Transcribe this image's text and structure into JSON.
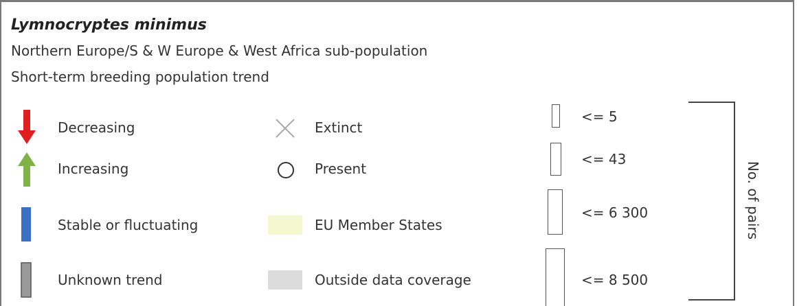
{
  "header": {
    "species": "Lymnocryptes minimus",
    "subpopulation": "Northern Europe/S & W Europe & West Africa sub-population",
    "trend_title": "Short-term breeding population trend"
  },
  "trend_legend": [
    {
      "label": "Decreasing",
      "icon": "arrow-down-icon",
      "color": "#e02020"
    },
    {
      "label": "Increasing",
      "icon": "arrow-up-icon",
      "color": "#7fb347"
    },
    {
      "label": "Stable or fluctuating",
      "icon": "stable-bar-icon",
      "color": "#3a6fc2"
    },
    {
      "label": "Unknown trend",
      "icon": "unknown-bar-icon",
      "color": "#9a9a9a"
    }
  ],
  "status_legend": [
    {
      "label": "Extinct",
      "icon": "cross-icon",
      "color": "#aaaaaa"
    },
    {
      "label": "Present",
      "icon": "circle-icon",
      "color": "#333333"
    },
    {
      "label": "EU Member States",
      "icon": "eu-patch",
      "color": "#f4f8cf"
    },
    {
      "label": "Outside data coverage",
      "icon": "outside-patch",
      "color": "#dcdcdc"
    }
  ],
  "size_legend": {
    "title": "No. of pairs",
    "classes": [
      {
        "label": "<= 5",
        "value": 5
      },
      {
        "label": "<= 43",
        "value": 43
      },
      {
        "label": "<= 6 300",
        "value": 6300
      },
      {
        "label": "<= 8 500",
        "value": 8500
      }
    ]
  }
}
